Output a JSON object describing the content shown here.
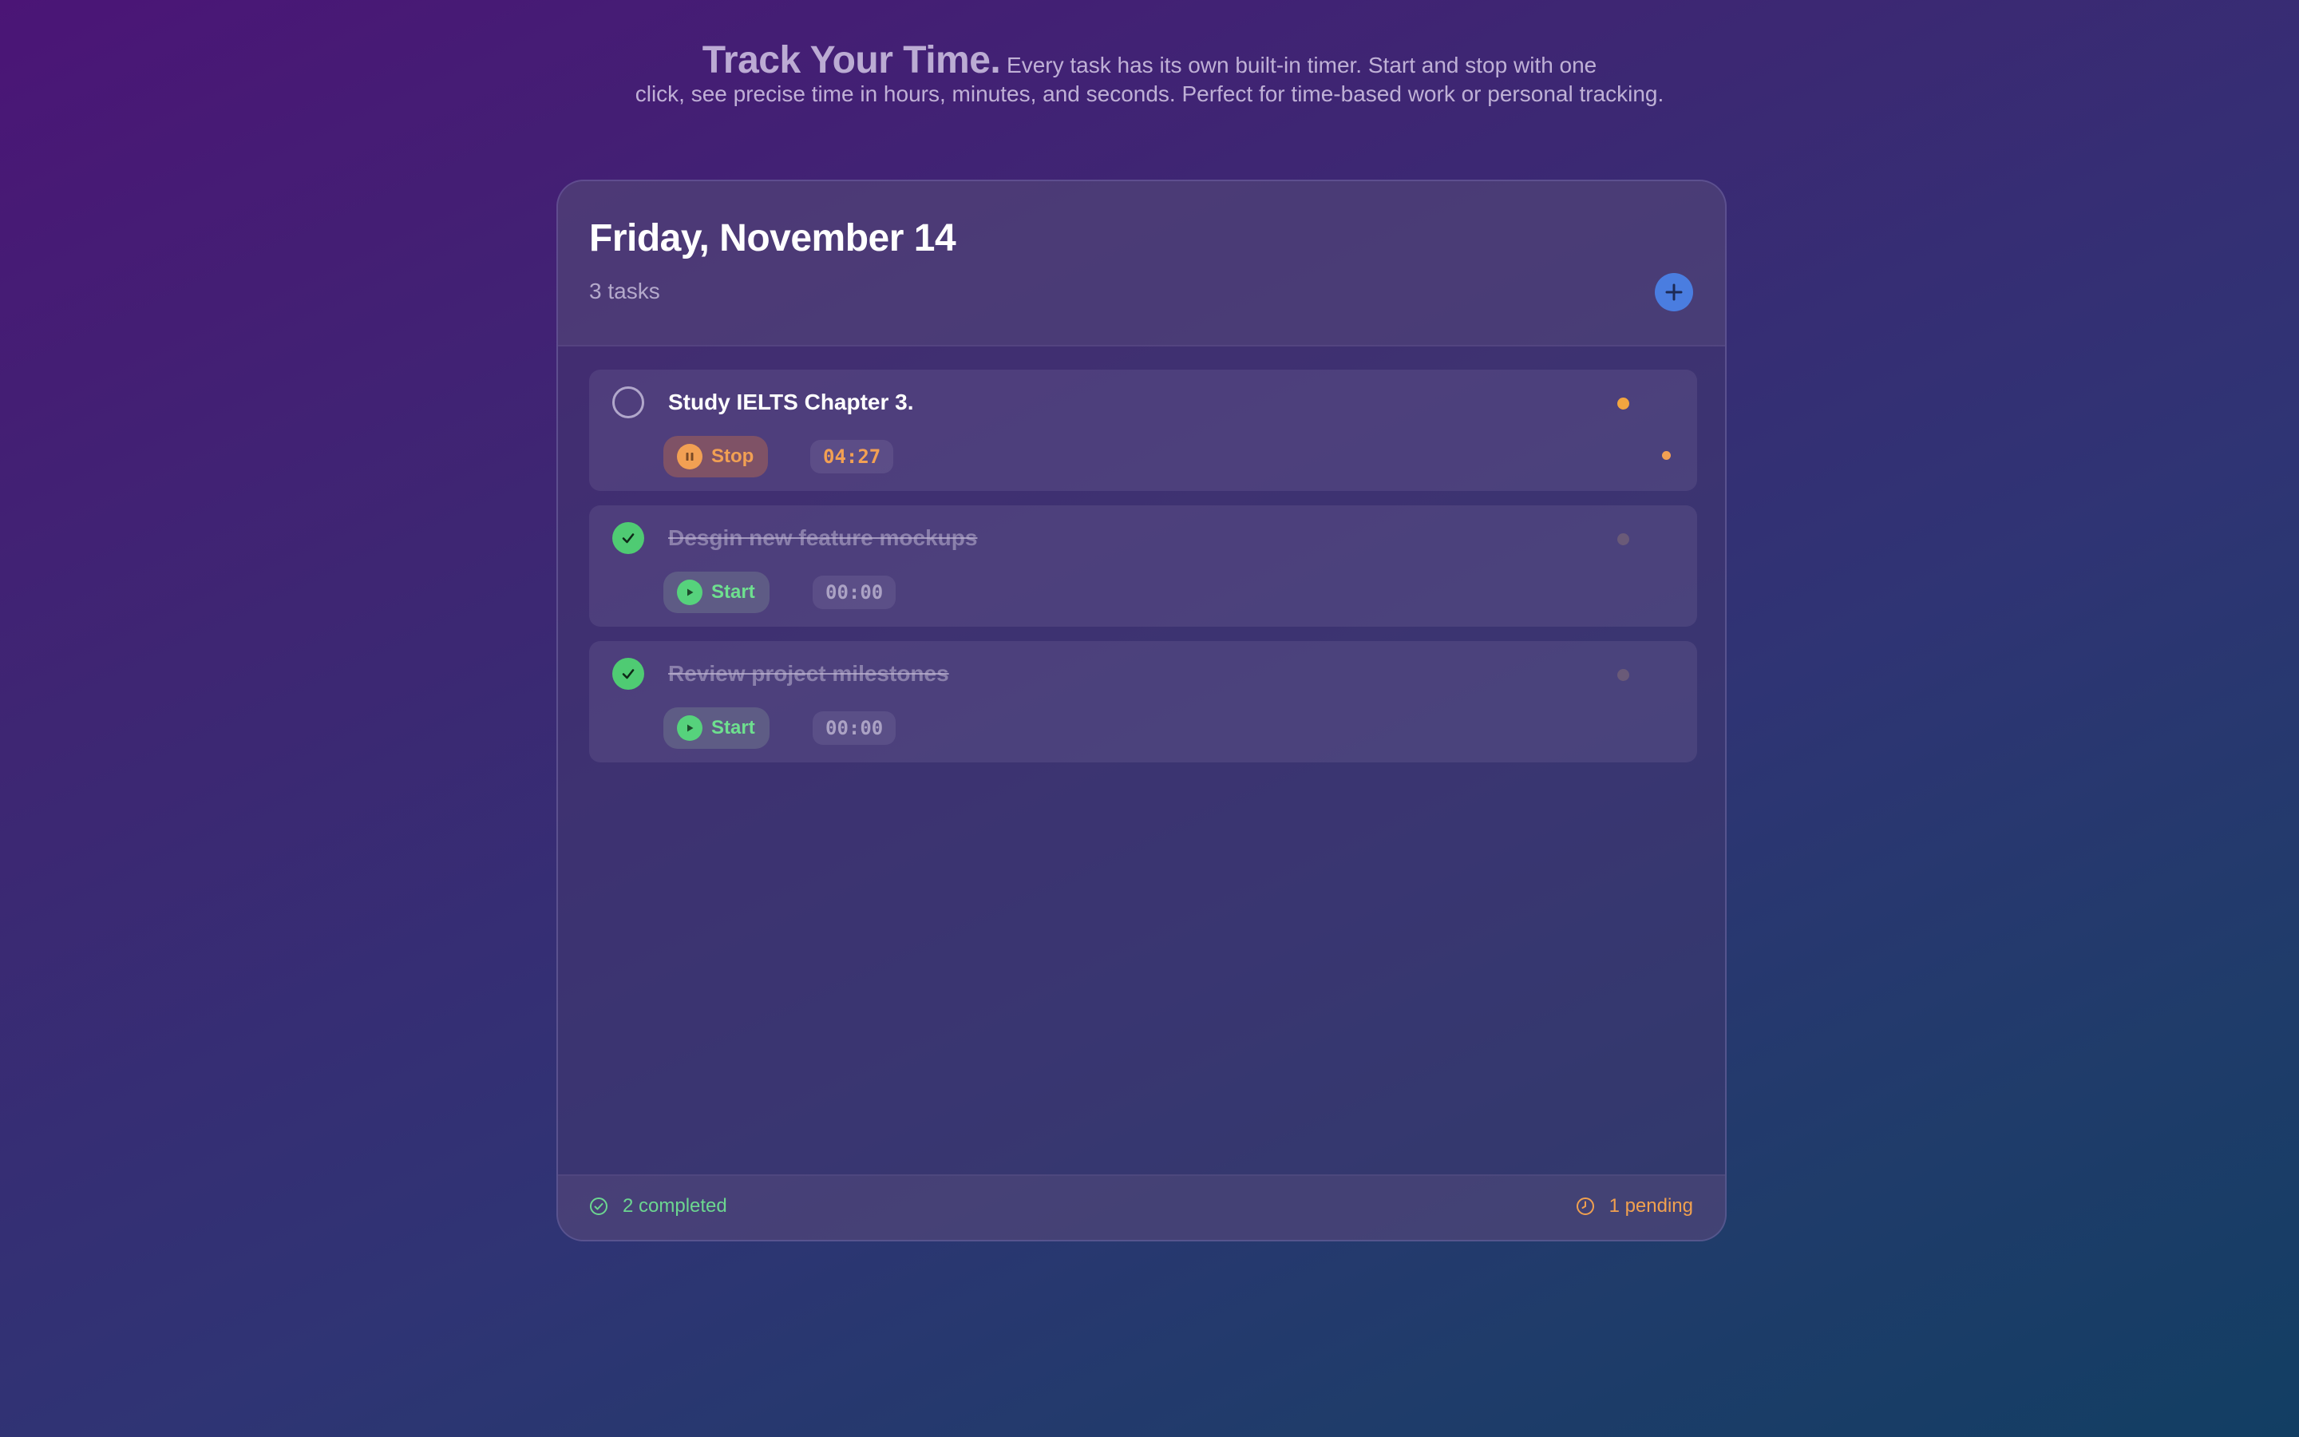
{
  "hero": {
    "title": "Track Your Time.",
    "line1": "Every task has its own built-in timer. Start and stop with one",
    "line2": "click, see precise time in hours, minutes, and seconds. Perfect  for time-based work or personal tracking."
  },
  "card": {
    "date": "Friday, November 14",
    "task_count": "3 tasks",
    "add_icon": "plus-icon"
  },
  "tasks": [
    {
      "title": "Study IELTS Chapter 3.",
      "completed": false,
      "running": true,
      "button_label": "Stop",
      "button_icon": "pause-icon",
      "time": "04:27",
      "priority_color": "#f2a53f"
    },
    {
      "title": "Desgin new feature mockups",
      "completed": true,
      "running": false,
      "button_label": "Start",
      "button_icon": "play-icon",
      "time": "00:00",
      "priority_color": "#6a5a78"
    },
    {
      "title": "Review project milestones",
      "completed": true,
      "running": false,
      "button_label": "Start",
      "button_icon": "play-icon",
      "time": "00:00",
      "priority_color": "#6a5a78"
    }
  ],
  "footer": {
    "completed": "2 completed",
    "pending": "1 pending"
  },
  "colors": {
    "accent_blue": "#4a7de0",
    "running_orange": "#f2a053",
    "done_green": "#4fcb73"
  }
}
